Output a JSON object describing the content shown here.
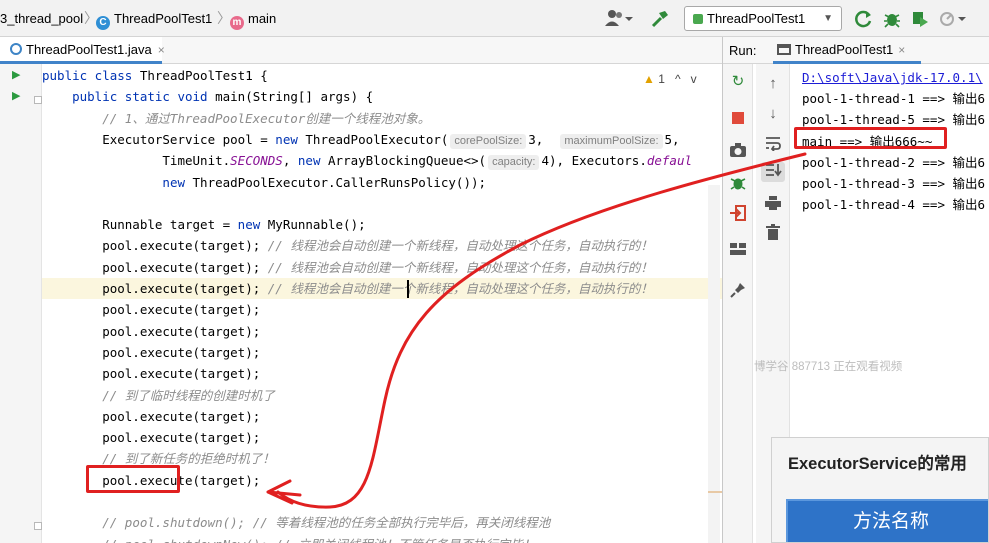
{
  "breadcrumb": {
    "module": "3_thread_pool",
    "class_name": "ThreadPoolTest1",
    "method": "main",
    "class_badge": "C",
    "method_badge": "m"
  },
  "toolbar": {
    "run_config": "ThreadPoolTest1",
    "icons": [
      "user-icon",
      "build-hammer-icon",
      "rerun-icon",
      "debug-bug-icon",
      "coverage-icon",
      "profiler-icon"
    ]
  },
  "editor": {
    "tab_label": "ThreadPoolTest1.java",
    "tab_close": "×",
    "warning_count": "1",
    "warning_glyph": "▲",
    "nav_up": "^",
    "nav_down": "v",
    "lines": [
      {
        "tokens": [
          {
            "t": "public class ",
            "c": "kw"
          },
          {
            "t": "ThreadPoolTest1 {"
          }
        ]
      },
      {
        "tokens": [
          {
            "t": "    "
          },
          {
            "t": "public static void ",
            "c": "kw"
          },
          {
            "t": "main(String[] args) {"
          }
        ]
      },
      {
        "tokens": [
          {
            "t": "        "
          },
          {
            "t": "// 1、通过ThreadPoolExecutor创建一个线程池对象。",
            "c": "cm"
          }
        ]
      },
      {
        "tokens": [
          {
            "t": "        ExecutorService pool = "
          },
          {
            "t": "new ",
            "c": "kw"
          },
          {
            "t": "ThreadPoolExecutor("
          },
          {
            "t": "corePoolSize:",
            "c": "hint"
          },
          {
            "t": "3,  "
          },
          {
            "t": "maximumPoolSize:",
            "c": "hint"
          },
          {
            "t": "5,"
          }
        ]
      },
      {
        "tokens": [
          {
            "t": "                TimeUnit."
          },
          {
            "t": "SECONDS",
            "c": "it"
          },
          {
            "t": ", "
          },
          {
            "t": "new ",
            "c": "kw"
          },
          {
            "t": "ArrayBlockingQueue<>("
          },
          {
            "t": "capacity:",
            "c": "hint"
          },
          {
            "t": "4), Executors."
          },
          {
            "t": "defaul",
            "c": "it"
          }
        ]
      },
      {
        "tokens": [
          {
            "t": "                "
          },
          {
            "t": "new ",
            "c": "kw"
          },
          {
            "t": "ThreadPoolExecutor.CallerRunsPolicy());"
          }
        ]
      },
      {
        "tokens": [
          {
            "t": ""
          }
        ]
      },
      {
        "tokens": [
          {
            "t": "        Runnable target = "
          },
          {
            "t": "new ",
            "c": "kw"
          },
          {
            "t": "MyRunnable();"
          }
        ]
      },
      {
        "tokens": [
          {
            "t": "        pool.execute(target); "
          },
          {
            "t": "// 线程池会自动创建一个新线程，自动处理这个任务，自动执行的！",
            "c": "cm"
          }
        ]
      },
      {
        "tokens": [
          {
            "t": "        pool.execute(target); "
          },
          {
            "t": "// 线程池会自动创建一个新线程，自动处理这个任务，自动执行的！",
            "c": "cm"
          }
        ]
      },
      {
        "tokens": [
          {
            "t": "        pool.execute(target); "
          },
          {
            "t": "// 线程池会自动创建一个新线程，自动处理这个任务，自动执行的！",
            "c": "cm"
          }
        ],
        "hl": true
      },
      {
        "tokens": [
          {
            "t": "        pool.execute(target);"
          }
        ]
      },
      {
        "tokens": [
          {
            "t": "        pool.execute(target);"
          }
        ]
      },
      {
        "tokens": [
          {
            "t": "        pool.execute(target);"
          }
        ]
      },
      {
        "tokens": [
          {
            "t": "        pool.execute(target);"
          }
        ]
      },
      {
        "tokens": [
          {
            "t": "        "
          },
          {
            "t": "// 到了临时线程的创建时机了",
            "c": "cm"
          }
        ]
      },
      {
        "tokens": [
          {
            "t": "        pool.execute(target);"
          }
        ]
      },
      {
        "tokens": [
          {
            "t": "        pool.execute(target);"
          }
        ]
      },
      {
        "tokens": [
          {
            "t": "        "
          },
          {
            "t": "// 到了新任务的拒绝时机了！",
            "c": "cm"
          }
        ]
      },
      {
        "tokens": [
          {
            "t": "        pool.execute(target);"
          }
        ]
      },
      {
        "tokens": [
          {
            "t": ""
          }
        ]
      },
      {
        "tokens": [
          {
            "t": "        "
          },
          {
            "t": "// pool.shutdown(); // 等着线程池的任务全部执行完毕后，再关闭线程池",
            "c": "cm"
          }
        ]
      },
      {
        "tokens": [
          {
            "t": "        "
          },
          {
            "t": "// pool.shutdownNow(); // 立即关闭线程池！不管任务是否执行完毕！",
            "c": "cm"
          }
        ]
      }
    ]
  },
  "run_panel": {
    "label": "Run:",
    "tab_label": "ThreadPoolTest1",
    "tab_close": "×",
    "console_lines": [
      {
        "text": "D:\\soft\\Java\\jdk-17.0.1\\",
        "path": true
      },
      {
        "text": "pool-1-thread-1 ==> 输出6"
      },
      {
        "text": "pool-1-thread-5 ==> 输出6"
      },
      {
        "text": "main ==> 输出666~~"
      },
      {
        "text": "pool-1-thread-2 ==> 输出6"
      },
      {
        "text": "pool-1-thread-3 ==> 输出6"
      },
      {
        "text": "pool-1-thread-4 ==> 输出6"
      }
    ],
    "watermark": "博学谷 887713 正在观看视频"
  },
  "popup": {
    "title": "ExecutorService的常用",
    "column_header": "方法名称"
  },
  "colors": {
    "annotation": "#e02020",
    "keyword": "#0033b3",
    "comment": "#8c8c8c",
    "link": "#1d1dd6"
  }
}
